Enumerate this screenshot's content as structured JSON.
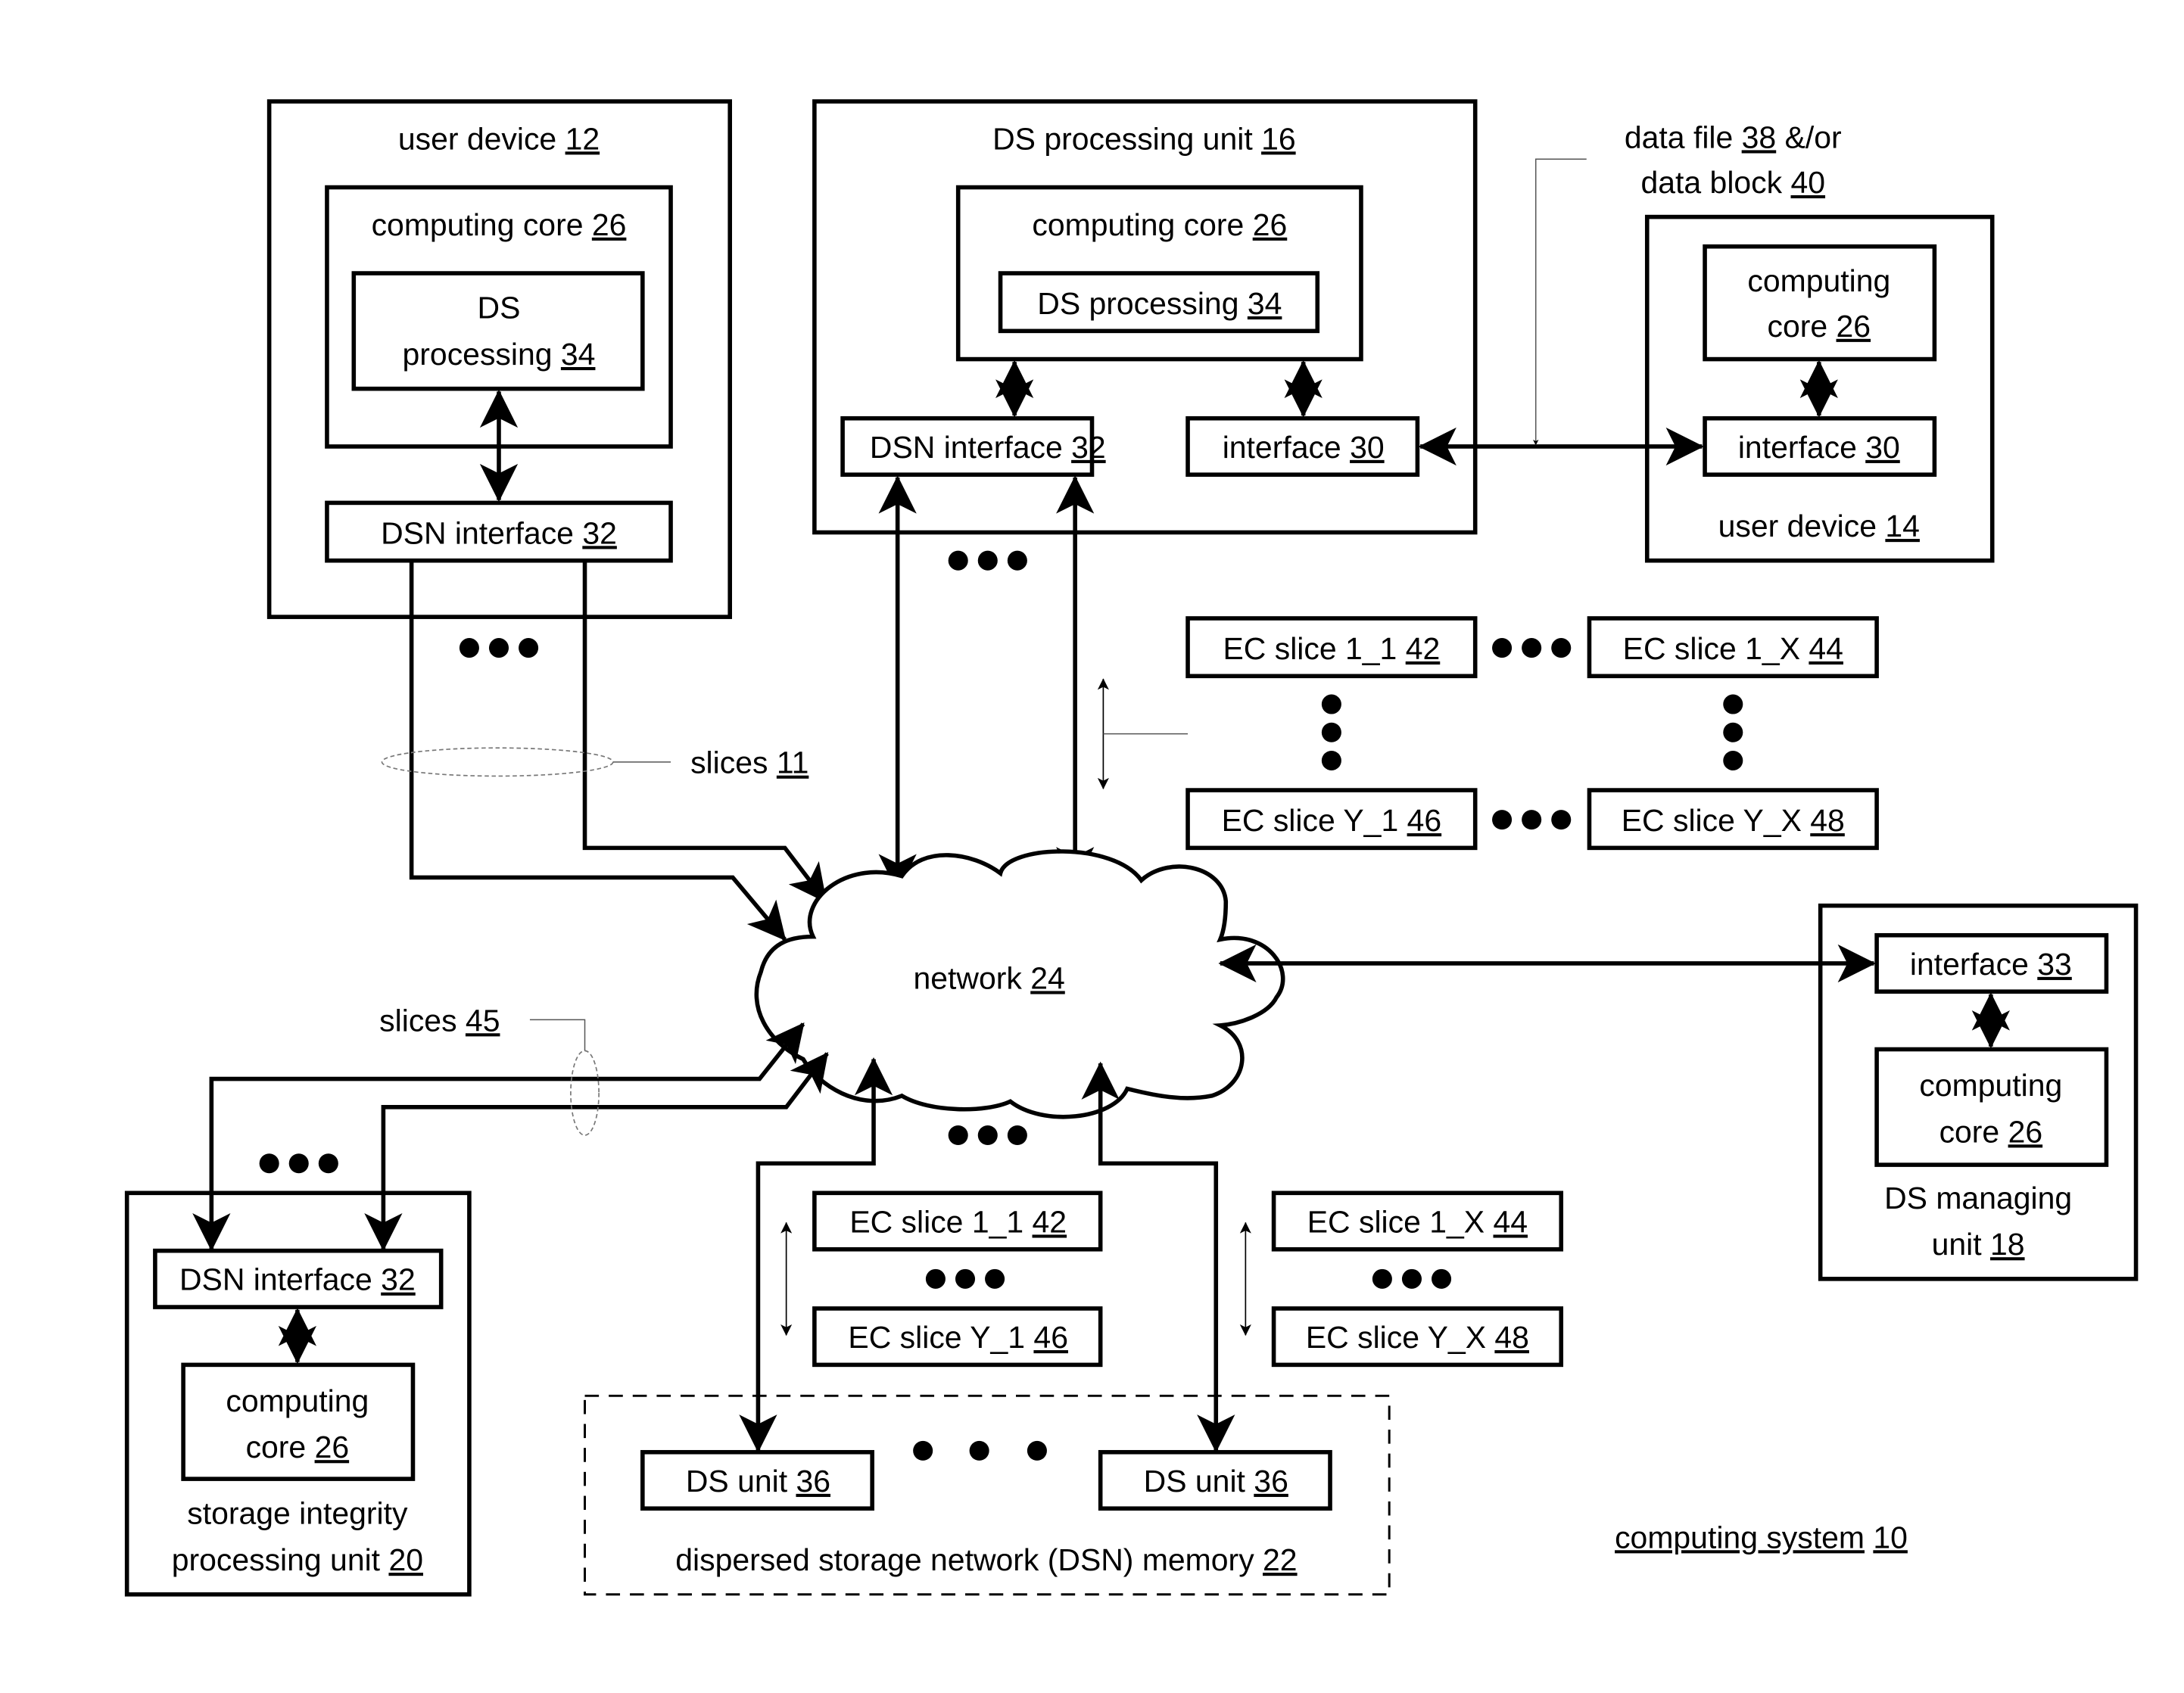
{
  "figure": {
    "system_label": {
      "text": "computing system",
      "ref": "10"
    }
  },
  "user_device_12": {
    "title": {
      "text": "user device",
      "ref": "12"
    },
    "computing_core": {
      "text": "computing core",
      "ref": "26"
    },
    "ds_processing": {
      "line1": "DS",
      "text": "processing",
      "ref": "34"
    },
    "dsn_interface": {
      "text": "DSN interface",
      "ref": "32"
    }
  },
  "ds_processing_unit_16": {
    "title": {
      "text": "DS processing unit",
      "ref": "16"
    },
    "computing_core": {
      "text": "computing core",
      "ref": "26"
    },
    "ds_processing": {
      "text": "DS processing",
      "ref": "34"
    },
    "dsn_interface": {
      "text": "DSN interface",
      "ref": "32"
    },
    "interface": {
      "text": "interface",
      "ref": "30"
    }
  },
  "data_annotation": {
    "line1": {
      "text": "data file",
      "ref": "38",
      "suffix": "&/or"
    },
    "line2": {
      "text": "data block",
      "ref": "40"
    }
  },
  "user_device_14": {
    "title": {
      "text": "user device",
      "ref": "14"
    },
    "computing_core": {
      "line1": "computing",
      "text": "core",
      "ref": "26"
    },
    "interface": {
      "text": "interface",
      "ref": "30"
    }
  },
  "slice_grid_top": {
    "cells": [
      {
        "text": "EC slice 1_1",
        "ref": "42"
      },
      {
        "text": "EC slice 1_X",
        "ref": "44"
      },
      {
        "text": "EC slice Y_1",
        "ref": "46"
      },
      {
        "text": "EC slice Y_X",
        "ref": "48"
      }
    ]
  },
  "slices_11": {
    "text": "slices",
    "ref": "11"
  },
  "slices_45": {
    "text": "slices",
    "ref": "45"
  },
  "network": {
    "text": "network",
    "ref": "24"
  },
  "ds_managing_unit_18": {
    "title_line1": "DS managing",
    "title": {
      "text": "unit",
      "ref": "18"
    },
    "interface": {
      "text": "interface",
      "ref": "33"
    },
    "computing_core": {
      "line1": "computing",
      "text": "core",
      "ref": "26"
    }
  },
  "storage_integrity_unit_20": {
    "title_line1": "storage integrity",
    "title": {
      "text": "processing unit",
      "ref": "20"
    },
    "dsn_interface": {
      "text": "DSN interface",
      "ref": "32"
    },
    "computing_core": {
      "line1": "computing",
      "text": "core",
      "ref": "26"
    }
  },
  "ds_unit_slices_left": {
    "top": {
      "text": "EC slice 1_1",
      "ref": "42"
    },
    "bottom": {
      "text": "EC slice Y_1",
      "ref": "46"
    }
  },
  "ds_unit_slices_right": {
    "top": {
      "text": "EC slice 1_X",
      "ref": "44"
    },
    "bottom": {
      "text": "EC slice Y_X",
      "ref": "48"
    }
  },
  "dsn_memory_22": {
    "title": {
      "text": "dispersed storage network (DSN) memory",
      "ref": "22"
    },
    "units": [
      {
        "text": "DS unit",
        "ref": "36"
      },
      {
        "text": "DS unit",
        "ref": "36"
      }
    ]
  }
}
